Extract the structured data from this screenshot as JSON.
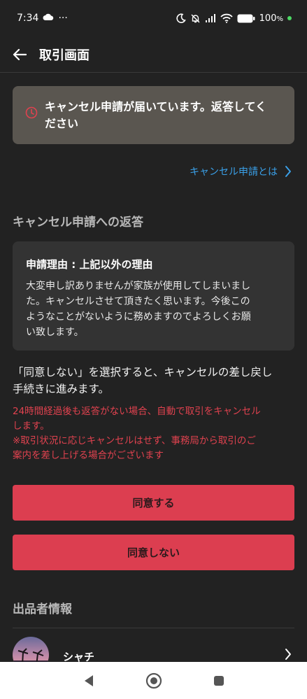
{
  "status_bar": {
    "time": "7:34",
    "more": "···",
    "battery": "100",
    "battery_unit": "%"
  },
  "header": {
    "title": "取引画面"
  },
  "alert": {
    "text_line1": "キャンセル申請が届いています。返答してく",
    "text_line2": "ださい"
  },
  "help_link": {
    "label": "キャンセル申請とは"
  },
  "response_section": {
    "title": "キャンセル申請への返答"
  },
  "reason": {
    "title": "申請理由 : 上記以外の理由",
    "body_lines": [
      "大変申し訳ありませんが家族が使用してしまいまし",
      "た。キャンセルさせて頂きたく思います。今後この",
      "ようなことがないように務めますのでよろしくお願",
      "い致します。"
    ]
  },
  "notice": {
    "lines": [
      "「同意しない」を選択すると、キャンセルの差し戻し",
      "手続きに進みます。"
    ]
  },
  "warning": {
    "lines": [
      "24時間経過後も返答がない場合、自動で取引をキャンセル",
      "します。",
      "※取引状況に応じキャンセルはせず、事務局から取引のご",
      "案内を差し上げる場合がございます"
    ]
  },
  "buttons": {
    "agree": "同意する",
    "disagree": "同意しない"
  },
  "seller_section": {
    "title": "出品者情報",
    "name": "シャチ"
  },
  "colors": {
    "background": "#222222",
    "accent": "#dc3e50",
    "link": "#3aa0e8",
    "warning_text": "#e0424f",
    "alert_bg": "#5a5650"
  },
  "icons": {
    "status": [
      "cloud-icon",
      "moon-icon",
      "bell-off-icon",
      "signal-icon",
      "wifi-icon",
      "battery-icon"
    ],
    "header": "back-arrow-icon",
    "alert": "clock-icon",
    "link": "chevron-right-icon",
    "nav": [
      "nav-back-icon",
      "nav-home-icon",
      "nav-recents-icon"
    ]
  }
}
